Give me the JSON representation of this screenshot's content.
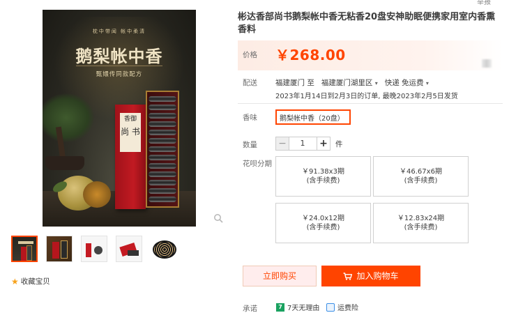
{
  "gallery": {
    "image_sub": "枕中带闻 帐中柔清",
    "image_title": "鹅梨帐中香",
    "image_desc": "甄嬛传同款配方",
    "box_label_1": "香御",
    "box_label_2": "尚 书",
    "favorite_label": "收藏宝贝"
  },
  "report_label": "举报",
  "product": {
    "title": "彬达香部尚书鹅梨帐中香无粘香20盘安神助眠便携家用室内香熏香料",
    "price_label": "价格",
    "price": "￥268.00"
  },
  "shipping": {
    "label": "配送",
    "from": "福建厦门 至",
    "to": "福建厦门湖里区",
    "method": "快递 免运费",
    "note": "2023年1月14日到2月3日的订单, 最晚2023年2月5日发货"
  },
  "sku": {
    "label": "香味",
    "option": "鹅梨帐中香（20盘）"
  },
  "quantity": {
    "label": "数量",
    "minus": "−",
    "value": "1",
    "plus": "+",
    "unit": "件"
  },
  "installment": {
    "label": "花呗分期",
    "options": [
      {
        "amount": "￥91.38x3期",
        "fee": "(含手续费)"
      },
      {
        "amount": "￥46.67x6期",
        "fee": "(含手续费)"
      },
      {
        "amount": "￥24.0x12期",
        "fee": "(含手续费)"
      },
      {
        "amount": "￥12.83x24期",
        "fee": "(含手续费)"
      }
    ]
  },
  "actions": {
    "buy_now": "立即购买",
    "add_to_cart": "加入购物车"
  },
  "promise": {
    "label": "承诺",
    "items": [
      {
        "icon": "seven-day-return-icon",
        "text": "7天无理由"
      },
      {
        "icon": "shipping-insurance-icon",
        "text": "运费险"
      }
    ]
  },
  "colors": {
    "accent": "#ff4400",
    "price_bg": "#fdece4",
    "star": "#f7a21b"
  }
}
